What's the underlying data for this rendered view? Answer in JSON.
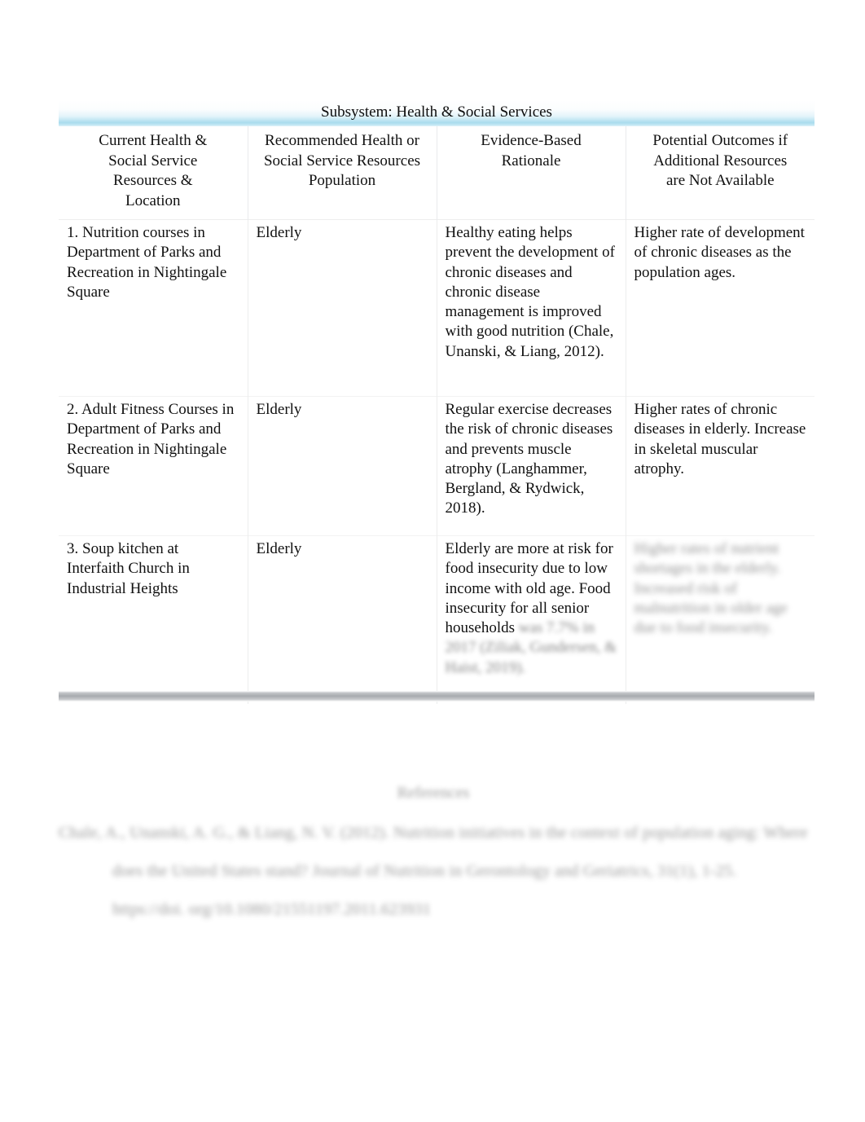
{
  "document": {
    "table_title": "Subsystem: Health & Social Services",
    "columns": [
      "Current Health & Social Service Resources & Location",
      "Recommended Health or Social Service Resources Population",
      "Evidence-Based Rationale",
      "Potential Outcomes if Additional Resources are Not Available"
    ],
    "column_headers": {
      "col1_line1": "Current Health &",
      "col1_line2": "Social Service",
      "col1_line3": "Resources &",
      "col1_line4": "Location",
      "col2_line1": "Recommended Health or",
      "col2_line2": "Social Service Resources",
      "col2_line3": "Population",
      "col3_line1": "Evidence-Based",
      "col3_line2": "Rationale",
      "col4_line1": "Potential Outcomes if",
      "col4_line2": "Additional Resources",
      "col4_line3": "are Not Available"
    },
    "rows": [
      {
        "resource": "1. Nutrition courses in Department of Parks and Recreation in Nightingale Square",
        "population": "Elderly",
        "rationale": "Healthy eating helps prevent the development of chronic diseases and chronic disease management is improved with good nutrition (Chale, Unanski, & Liang, 2012).",
        "rationale_blurred": "",
        "outcomes": "Higher rate of development of chronic diseases as the population ages.",
        "outcomes_blurred": ""
      },
      {
        "resource": "2. Adult Fitness Courses in Department of Parks and Recreation in Nightingale Square",
        "population": "Elderly",
        "rationale": "Regular exercise decreases the risk of chronic diseases and prevents muscle atrophy (Langhammer, Bergland, & Rydwick, 2018).",
        "rationale_blurred": "",
        "outcomes": "Higher rates of chronic diseases in elderly. Increase in skeletal muscular atrophy.",
        "outcomes_blurred": ""
      },
      {
        "resource": "3. Soup kitchen at Interfaith Church in Industrial Heights",
        "population": "Elderly",
        "rationale": "Elderly are more at risk for food insecurity due to low income with old age. Food insecurity for all senior households",
        "rationale_blurred": "was 7.7% in 2017 (Ziliak, Gundersen, & Haist, 2019).",
        "outcomes": "",
        "outcomes_blurred": "Higher rates of nutrient shortages in the elderly. Increased risk of malnutrition in older age due to food insecurity."
      }
    ],
    "references": {
      "heading": "References",
      "entry_line1": "Chale, A., Unanski, A. G., & Liang, N. V. (2012). Nutrition initiatives in the context of",
      "entry_line2": "population aging: Where does the United States stand? Journal of Nutrition in",
      "entry_line3": "Gerontology and Geriatrics, 31(1), 1-25. https://doi.",
      "entry_line4": "org/10.1080/21551197.2011.623931"
    }
  }
}
